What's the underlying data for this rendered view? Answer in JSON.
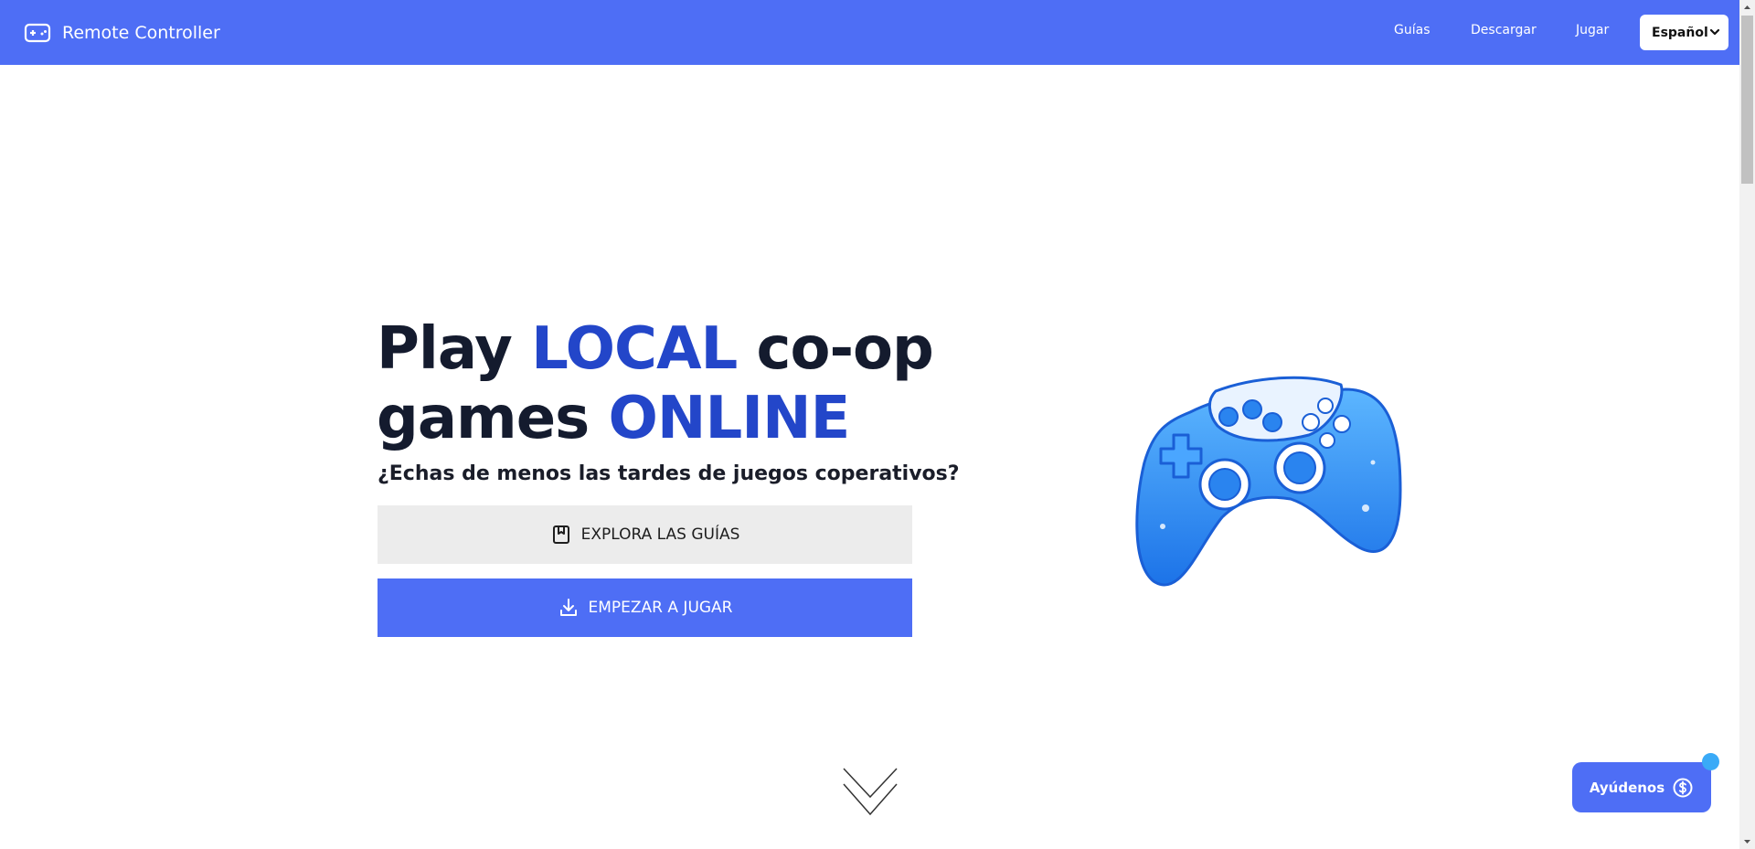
{
  "header": {
    "brand_name": "Remote Controller",
    "brand_icon": "gamepad-icon",
    "nav": [
      {
        "label": "Guías"
      },
      {
        "label": "Descargar"
      },
      {
        "label": "Jugar"
      }
    ],
    "language": {
      "selected": "Español",
      "icon": "chevron-down-icon"
    }
  },
  "hero": {
    "headline": {
      "w1": "Play ",
      "w2": "LOCAL",
      "w3": " co-op",
      "w4": "games ",
      "w5": "ONLINE"
    },
    "subtitle": "¿Echas de menos las tardes de juegos coperativos?",
    "guides_button": {
      "label": "EXPLORA LAS GUÍAS",
      "icon": "bookmark-icon"
    },
    "play_button": {
      "label": "EMPEZAR A JUGAR",
      "icon": "download-icon"
    },
    "illustration": "gamepad-illustration",
    "scroll_hint_icon": "double-chevron-down-icon"
  },
  "help_button": {
    "label": "Ayúdenos",
    "icon": "dollar-icon"
  },
  "colors": {
    "primary": "#4e6ef5",
    "headline_accent": "#2346c9",
    "headline_dark": "#141b2e",
    "secondary_button": "#ececec",
    "notification_dot": "#3aaaf7"
  }
}
